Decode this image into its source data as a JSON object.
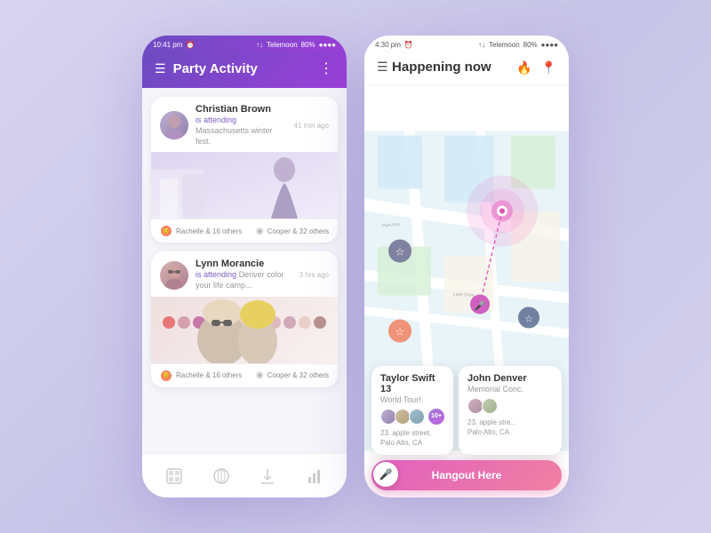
{
  "leftPhone": {
    "statusBar": {
      "time": "10:41 pm",
      "carrier": "Telemoon",
      "battery": "80%"
    },
    "header": {
      "title": "Party Activity",
      "menuLabel": "☰",
      "moreLabel": "⋮"
    },
    "cards": [
      {
        "name": "Christian Brown",
        "timeAgo": "41 min ago",
        "actionText": "is attending",
        "eventName": "Massachusetts winter fest.",
        "footerLeft": "Rachelle & 16 others",
        "footerRight": "Cooper & 32 others"
      },
      {
        "name": "Lynn Morancie",
        "timeAgo": "3 hrs ago",
        "actionText": "is attending",
        "eventName": "Denver color your life camp...",
        "footerLeft": "Rachelle & 16 others",
        "footerRight": "Cooper & 32 others"
      }
    ],
    "bottomNav": [
      {
        "icon": "🖼",
        "label": "gallery"
      },
      {
        "icon": "🔍",
        "label": "explore"
      },
      {
        "icon": "⬇",
        "label": "download"
      },
      {
        "icon": "📊",
        "label": "stats"
      }
    ]
  },
  "rightPhone": {
    "statusBar": {
      "time": "4:30 pm",
      "carrier": "Telemoon",
      "battery": "80%"
    },
    "header": {
      "title": "Happening now",
      "menuLabel": "☰",
      "fireIcon": "🔥",
      "locationIcon": "📍"
    },
    "events": [
      {
        "title": "Taylor Swift 13",
        "subtitle": "World Tour!",
        "plusCount": "10+",
        "address": "23. apple street,\nPalo Alto, CA"
      },
      {
        "title": "John Denver",
        "subtitle": "Memorial Conc.",
        "address": "23. apple stre...\nPalo Alto, CA"
      }
    ],
    "hangoutButton": "Hangout Here"
  },
  "colors": {
    "purple": "#7c5cbf",
    "gradStart": "#6c4bc1",
    "gradEnd": "#9b3fd8",
    "pink": "#e060c0",
    "orange": "#f4845f",
    "dotColors": [
      "#e87878",
      "#d4a0b0",
      "#c878a8",
      "#e8c0c0",
      "#d8b0b8",
      "#c8a0b0",
      "#e8d0d0",
      "#d0a8b8"
    ]
  }
}
